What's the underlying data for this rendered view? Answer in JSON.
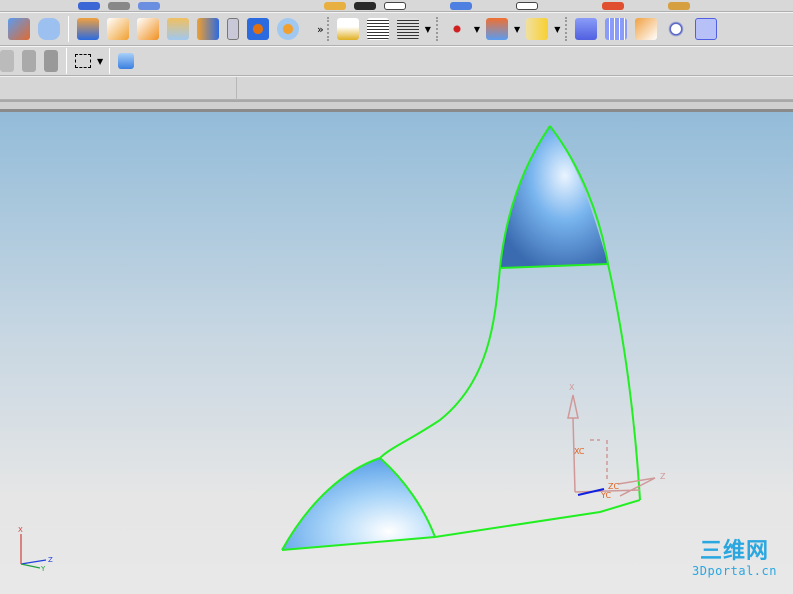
{
  "toolbar_row2": [
    "shaded-view",
    "wire-view",
    "block",
    "sweep",
    "flange",
    "box-section",
    "shell",
    "thread",
    "hole",
    "boss",
    "more",
    "edit-feature",
    "bolt",
    "bolt-variant",
    "point-set",
    "surface-project",
    "sheet-face",
    "through-curves",
    "curve-mesh",
    "studio-surface",
    "swept-edit",
    "face-edit"
  ],
  "toolbar_row3": [
    "rotate",
    "snap-point",
    "move-handle",
    "select-rectangle",
    "view-cube"
  ],
  "overflow_label": "»",
  "triad": {
    "x": "X",
    "y": "Y",
    "z": "Z"
  },
  "wcs": {
    "xc": "XC",
    "yc": "YC",
    "zc": "ZC",
    "x": "X",
    "z": "Z"
  },
  "watermark": {
    "cn": "三维网",
    "en": "3Dportal.cn"
  },
  "colors": {
    "edge": "#22ee22",
    "surface": "#6aa8ea",
    "accent": "#2aa7e0"
  }
}
